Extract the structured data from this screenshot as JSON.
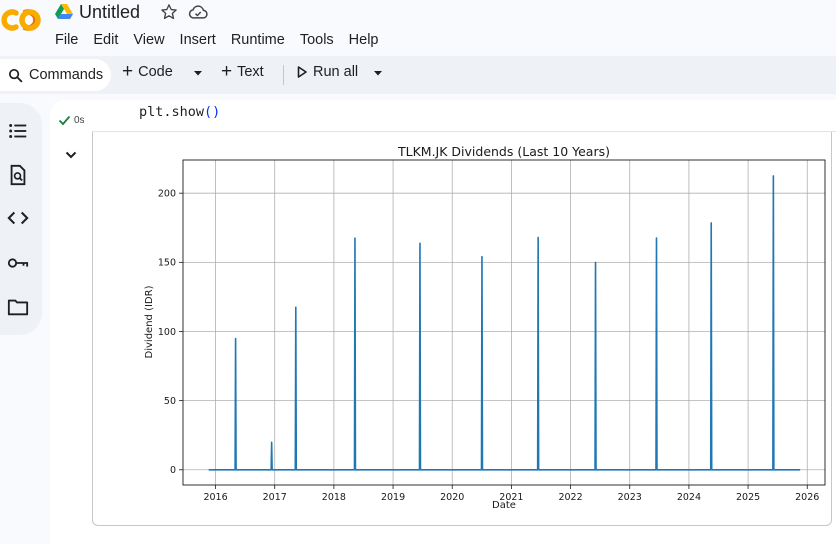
{
  "app": {
    "title": "Untitled",
    "menu": [
      "File",
      "Edit",
      "View",
      "Insert",
      "Runtime",
      "Tools",
      "Help"
    ]
  },
  "icons": {
    "logo": "colab-logo",
    "drive": "google-drive-icon",
    "star": "star-icon",
    "cloud": "cloud-saved-icon"
  },
  "toolbar": {
    "commands_label": "Commands",
    "code_label": "Code",
    "text_label": "Text",
    "run_all_label": "Run all"
  },
  "cell": {
    "status": "0s",
    "code": "plt.show",
    "code_parens": "()"
  },
  "colors": {
    "accent": "#1f77b4",
    "success": "#188038"
  },
  "chart_data": {
    "type": "line",
    "title": "TLKM.JK Dividends (Last 10 Years)",
    "xlabel": "Date",
    "ylabel": "Dividend (IDR)",
    "xlim": [
      2015.45,
      2026.3
    ],
    "ylim": [
      -11,
      224
    ],
    "x_ticks": [
      "2016",
      "2017",
      "2018",
      "2019",
      "2020",
      "2021",
      "2022",
      "2023",
      "2024",
      "2025",
      "2026"
    ],
    "y_ticks": [
      0,
      50,
      100,
      150,
      200
    ],
    "grid": true,
    "series": [
      {
        "x": [
          "2015-11-20",
          "2016-05-01",
          "2016-05-04",
          "2016-05-07",
          "2016-12-10",
          "2016-12-13",
          "2016-12-16",
          "2017-05-08",
          "2017-05-11",
          "2017-05-14",
          "2018-05-08",
          "2018-05-11",
          "2018-05-14",
          "2019-06-13",
          "2019-06-16",
          "2019-06-19",
          "2020-06-30",
          "2020-07-03",
          "2020-07-06",
          "2021-06-12",
          "2021-06-15",
          "2021-06-18",
          "2022-06-01",
          "2022-06-04",
          "2022-06-07",
          "2023-06-12",
          "2023-06-15",
          "2023-06-18",
          "2024-05-15",
          "2024-05-18",
          "2024-05-21",
          "2025-06-03",
          "2025-06-06",
          "2025-06-09",
          "2025-11-18"
        ],
        "values": [
          0,
          0,
          94.9,
          0,
          0,
          19.9,
          0,
          0,
          117.5,
          0,
          0,
          167.5,
          0,
          0,
          163.8,
          0,
          0,
          154.1,
          0,
          0,
          168.0,
          0,
          0,
          149.9,
          0,
          0,
          167.6,
          0,
          0,
          178.5,
          0,
          0,
          212.5,
          0,
          0
        ]
      }
    ]
  }
}
